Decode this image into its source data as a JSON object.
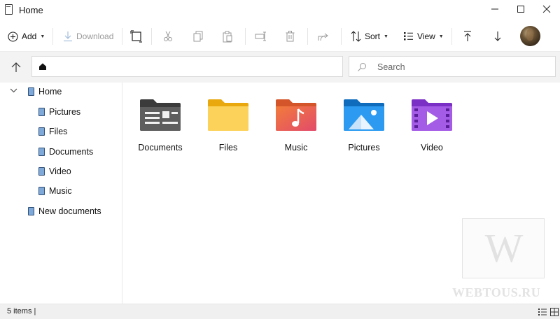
{
  "window": {
    "title": "Home"
  },
  "toolbar": {
    "add_label": "Add",
    "download_label": "Download",
    "sort_label": "Sort",
    "view_label": "View"
  },
  "address": {
    "location": "Home"
  },
  "search": {
    "placeholder": "Search"
  },
  "sidebar": {
    "items": [
      {
        "label": "Home",
        "level": 0,
        "expanded": true
      },
      {
        "label": "Pictures",
        "level": 1
      },
      {
        "label": "Files",
        "level": 1
      },
      {
        "label": "Documents",
        "level": 1
      },
      {
        "label": "Video",
        "level": 1
      },
      {
        "label": "Music",
        "level": 1
      },
      {
        "label": "New documents",
        "level": 0
      }
    ]
  },
  "main": {
    "items": [
      {
        "name": "Documents",
        "icon": "documents-folder-icon",
        "color": "#4a4a4a"
      },
      {
        "name": "Files",
        "icon": "files-folder-icon",
        "color": "#f5c518"
      },
      {
        "name": "Music",
        "icon": "music-folder-icon",
        "color": "#e8603c"
      },
      {
        "name": "Pictures",
        "icon": "pictures-folder-icon",
        "color": "#1a86d9"
      },
      {
        "name": "Video",
        "icon": "video-folder-icon",
        "color": "#8b3fd1"
      }
    ]
  },
  "watermark": {
    "letter": "W",
    "text": "WEBTOUS.RU"
  },
  "status": {
    "text": "5 items |"
  }
}
